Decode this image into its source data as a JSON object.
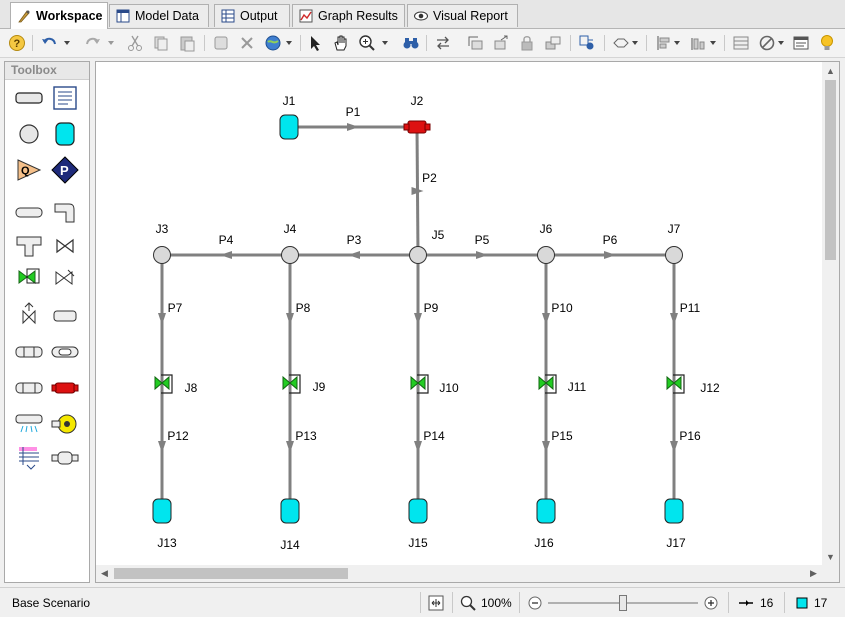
{
  "tabs": [
    {
      "label": "Workspace",
      "icon": "workspace-icon",
      "active": true
    },
    {
      "label": "Model Data",
      "icon": "model-data-icon",
      "active": false
    },
    {
      "label": "Output",
      "icon": "output-icon",
      "active": false
    },
    {
      "label": "Graph Results",
      "icon": "graph-results-icon",
      "active": false
    },
    {
      "label": "Visual Report",
      "icon": "visual-report-icon",
      "active": false
    }
  ],
  "toolbox": {
    "title": "Toolbox"
  },
  "network": {
    "junctions": [
      {
        "id": "J1",
        "type": "reservoir"
      },
      {
        "id": "J2",
        "type": "control-valve"
      },
      {
        "id": "J3",
        "type": "branch"
      },
      {
        "id": "J4",
        "type": "branch"
      },
      {
        "id": "J5",
        "type": "branch"
      },
      {
        "id": "J6",
        "type": "branch"
      },
      {
        "id": "J7",
        "type": "branch"
      },
      {
        "id": "J8",
        "type": "check-valve"
      },
      {
        "id": "J9",
        "type": "check-valve"
      },
      {
        "id": "J10",
        "type": "check-valve"
      },
      {
        "id": "J11",
        "type": "check-valve"
      },
      {
        "id": "J12",
        "type": "check-valve"
      },
      {
        "id": "J13",
        "type": "reservoir"
      },
      {
        "id": "J14",
        "type": "reservoir"
      },
      {
        "id": "J15",
        "type": "reservoir"
      },
      {
        "id": "J16",
        "type": "reservoir"
      },
      {
        "id": "J17",
        "type": "reservoir"
      }
    ],
    "pipes": [
      {
        "id": "P1",
        "from": "J1",
        "to": "J2"
      },
      {
        "id": "P2",
        "from": "J2",
        "to": "J5"
      },
      {
        "id": "P3",
        "from": "J5",
        "to": "J4"
      },
      {
        "id": "P4",
        "from": "J4",
        "to": "J3"
      },
      {
        "id": "P5",
        "from": "J5",
        "to": "J6"
      },
      {
        "id": "P6",
        "from": "J6",
        "to": "J7"
      },
      {
        "id": "P7",
        "from": "J3",
        "to": "J8"
      },
      {
        "id": "P8",
        "from": "J4",
        "to": "J9"
      },
      {
        "id": "P9",
        "from": "J5",
        "to": "J10"
      },
      {
        "id": "P10",
        "from": "J6",
        "to": "J11"
      },
      {
        "id": "P11",
        "from": "J7",
        "to": "J12"
      },
      {
        "id": "P12",
        "from": "J8",
        "to": "J13"
      },
      {
        "id": "P13",
        "from": "J9",
        "to": "J14"
      },
      {
        "id": "P14",
        "from": "J10",
        "to": "J15"
      },
      {
        "id": "P15",
        "from": "J11",
        "to": "J16"
      },
      {
        "id": "P16",
        "from": "J12",
        "to": "J17"
      }
    ]
  },
  "status": {
    "scenario": "Base Scenario",
    "zoom": "100%",
    "zoom_slider_fraction": 0.5,
    "pipe_count": "16",
    "junction_count": "17"
  },
  "colors": {
    "pipe": "#808080",
    "reservoir": "#00e5ee",
    "branch": "#d9d9d9",
    "check_valve": "#22cc22",
    "control_valve": "#dd1111"
  }
}
